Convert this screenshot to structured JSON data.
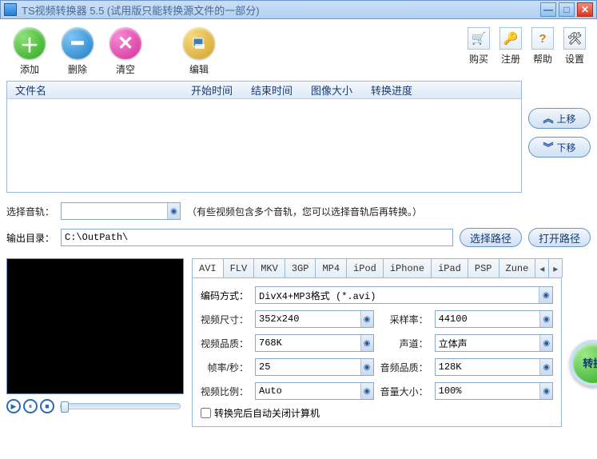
{
  "window": {
    "title": "TS视频转换器 5.5 (试用版只能转换源文件的一部分)"
  },
  "toolbar": {
    "add": "添加",
    "delete": "删除",
    "clear": "清空",
    "edit": "编辑"
  },
  "right_tools": {
    "buy": "购买",
    "register": "注册",
    "help": "帮助",
    "settings": "设置"
  },
  "table": {
    "filename": "文件名",
    "start_time": "开始时间",
    "end_time": "结束时间",
    "image_size": "图像大小",
    "progress": "转换进度"
  },
  "move": {
    "up": "上移",
    "down": "下移"
  },
  "audio_row": {
    "label": "选择音轨：",
    "value": "",
    "note": "（有些视频包含多个音轨，您可以选择音轨后再转换。）"
  },
  "output_row": {
    "label": "输出目录：",
    "value": "C:\\OutPath\\",
    "choose": "选择路径",
    "open": "打开路径"
  },
  "tabs": [
    "AVI",
    "FLV",
    "MKV",
    "3GP",
    "MP4",
    "iPod",
    "iPhone",
    "iPad",
    "PSP",
    "Zune"
  ],
  "settings": {
    "encode_label": "编码方式：",
    "encode_value": "DivX4+MP3格式 (*.avi)",
    "vsize_label": "视频尺寸：",
    "vsize_value": "352x240",
    "srate_label": "采样率：",
    "srate_value": "44100",
    "vqual_label": "视频品质：",
    "vqual_value": "768K",
    "chan_label": "声道：",
    "chan_value": "立体声",
    "fps_label": "帧率/秒：",
    "fps_value": "25",
    "aqual_label": "音频品质：",
    "aqual_value": "128K",
    "ratio_label": "视频比例：",
    "ratio_value": "Auto",
    "vol_label": "音量大小：",
    "vol_value": "100%",
    "shutdown": "转换完后自动关闭计算机"
  },
  "convert": "转换"
}
